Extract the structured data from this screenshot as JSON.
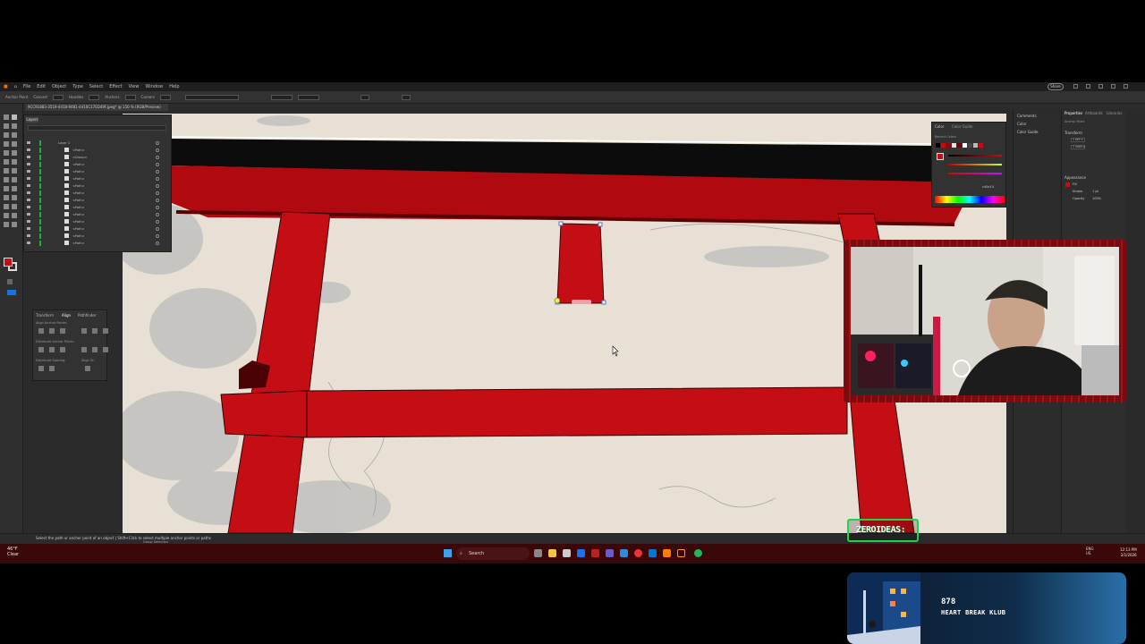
{
  "menubar": {
    "items": [
      "File",
      "Edit",
      "Object",
      "Type",
      "Select",
      "Effect",
      "View",
      "Window",
      "Help"
    ],
    "share_label": "Share"
  },
  "control": {
    "items": [
      "Anchor Point",
      "Convert",
      "Handles",
      "Anchors",
      "Corners"
    ]
  },
  "document": {
    "tab_title": "9CC91883-3519-4418-9481-4410C17ED49F.jpeg* @ 150 % (RGB/Preview)"
  },
  "layers_panel": {
    "tab_label": "Layers",
    "layer_title": "Layer 1",
    "rows": [
      "<Path>",
      "<Group>",
      "<Path>",
      "<Path>",
      "<Path>",
      "<Path>",
      "<Path>",
      "<Path>",
      "<Path>",
      "<Path>",
      "<Path>",
      "<Path>",
      "<Path>",
      "<Path>"
    ]
  },
  "align_panel": {
    "tabs": [
      "Transform",
      "Align",
      "Pathfinder"
    ],
    "labels": [
      "Align Anchor Points:",
      "Distribute Anchor Points:",
      "Distribute Spacing:",
      "Align To:"
    ]
  },
  "color_panel": {
    "tabs": [
      "Color",
      "Color Guide"
    ],
    "recent_label": "Recent Colors",
    "hex_value": "c40e14"
  },
  "libraries_panel": {
    "items": [
      "Comments",
      "Color",
      "Color Guide"
    ]
  },
  "properties_panel": {
    "tabs": [
      "Properties",
      "Artboards",
      "Libraries"
    ],
    "labels": [
      "Anchor Point",
      "Transform",
      "Appearance",
      "Fill",
      "Stroke",
      "Opacity"
    ],
    "values": [
      "1.087 in",
      "1.3996 in",
      "1 pt",
      "100%"
    ]
  },
  "statusbar": {
    "hint": "Select the path or anchor point of an object  |  Shift+Click to select multiple anchor points or paths",
    "mode": "Group Selection"
  },
  "taskbar": {
    "weather_temp": "46°F",
    "weather_desc": "Clear",
    "search_placeholder": "Search",
    "tray_lang": "ENG",
    "tray_region": "US",
    "clock_time": "12:13 PM",
    "clock_date": "2/1/2026"
  },
  "overlay": {
    "logo_text": "ZEROIDEAS:",
    "now_playing": {
      "song": "878",
      "artist": "HEART BREAK KLUB"
    }
  },
  "colors": {
    "torii_red": "#c40e14",
    "canvas_bg": "#e8e0d4",
    "ui_dark": "#2b2b2b",
    "taskbar_bg": "#3a0808",
    "logo_green": "#1fd34a"
  }
}
